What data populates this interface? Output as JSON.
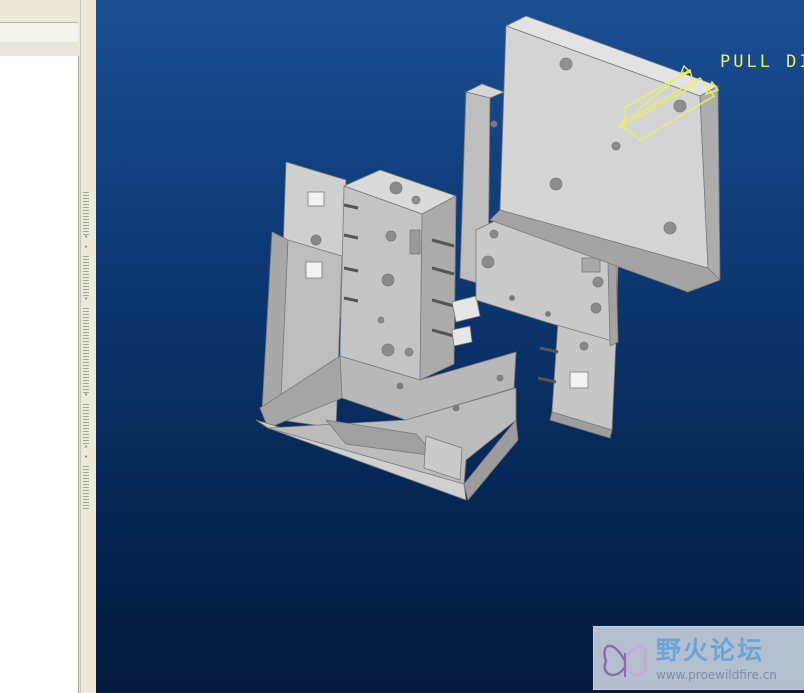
{
  "viewport": {
    "pull_direction_label": "PULL DI",
    "pull_direction_arrow_color": "#e8f060",
    "part_color": "#c8c8c8",
    "background_top": "#1a4f93",
    "background_bottom": "#031a3d"
  },
  "sash": {
    "expand_arrow": "˄",
    "collapse_arrow": "˅"
  },
  "watermark": {
    "title": "野火论坛",
    "url": "www.proewildfire.cn",
    "logo_icon": "butterfly-logo-icon"
  }
}
